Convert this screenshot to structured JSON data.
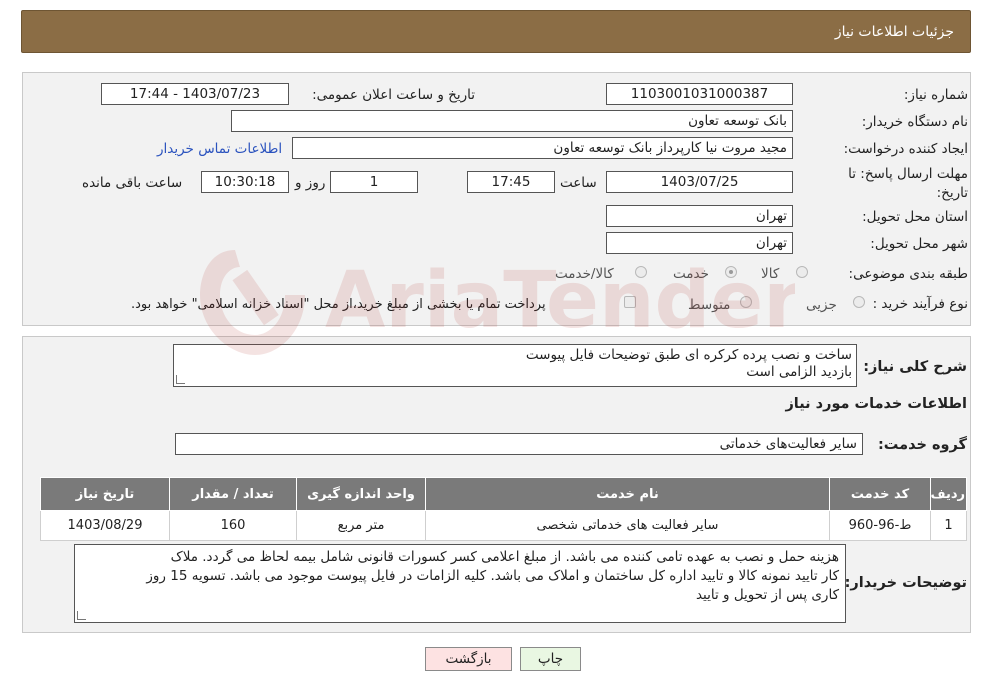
{
  "header": {
    "title": "جزئیات اطلاعات نیاز"
  },
  "form": {
    "need_number_label": "شماره نیاز:",
    "need_number": "1103001031000387",
    "announce_label": "تاریخ و ساعت اعلان عمومی:",
    "announce_value": "1403/07/23 - 17:44",
    "buyer_org_label": "نام دستگاه خریدار:",
    "buyer_org": "بانک توسعه تعاون",
    "creator_label": "ایجاد کننده درخواست:",
    "creator": "مجید مروت نیا کارپرداز بانک توسعه تعاون",
    "contact_link": "اطلاعات تماس خریدار",
    "deadline_label": "مهلت ارسال پاسخ: تا تاریخ:",
    "deadline_date": "1403/07/25",
    "time_label": "ساعت",
    "deadline_time": "17:45",
    "days_value": "1",
    "days_label": "روز و",
    "remaining_time": "10:30:18",
    "remaining_label": "ساعت باقی مانده",
    "province_label": "استان محل تحویل:",
    "province": "تهران",
    "city_label": "شهر محل تحویل:",
    "city": "تهران",
    "category_label": "طبقه بندی موضوعی:",
    "category_options": [
      "کالا",
      "خدمت",
      "کالا/خدمت"
    ],
    "category_selected": "خدمت",
    "process_label": "نوع فرآیند خرید :",
    "process_options": [
      "جزیی",
      "متوسط"
    ],
    "payment_note": "پرداخت تمام یا بخشی از مبلغ خرید،از محل \"اسناد خزانه اسلامی\" خواهد بود."
  },
  "summary": {
    "label": "شرح کلی نیاز:",
    "lines": [
      "ساخت و نصب پرده کرکره ای طبق توضیحات فایل پیوست",
      "بازدید الزامی است"
    ],
    "services_title": "اطلاعات خدمات مورد نیاز",
    "service_group_label": "گروه خدمت:",
    "service_group": "سایر فعالیت‌های خدماتی"
  },
  "table": {
    "headers": [
      "ردیف",
      "کد خدمت",
      "نام خدمت",
      "واحد اندازه گیری",
      "تعداد / مقدار",
      "تاریخ نیاز"
    ],
    "rows": [
      [
        "1",
        "ط-96-960",
        "سایر فعالیت های خدماتی شخصی",
        "متر مربع",
        "160",
        "1403/08/29"
      ]
    ]
  },
  "buyer_notes": {
    "label": "توضیحات خریدار:",
    "lines": [
      "هزینه حمل و نصب به عهده تامی کننده می باشد. از مبلغ اعلامی کسر کسورات قانونی شامل بیمه لحاظ می گردد. ملاک",
      "کار تایید نمونه کالا و تایید اداره کل ساختمان و املاک می باشد. کلیه الزامات در فایل پیوست موجود می باشد. تسویه 15 روز",
      "کاری پس از تحویل و تایید"
    ]
  },
  "buttons": {
    "print": "چاپ",
    "back": "بازگشت"
  },
  "watermark": {
    "text": "AriaTender.neT"
  }
}
